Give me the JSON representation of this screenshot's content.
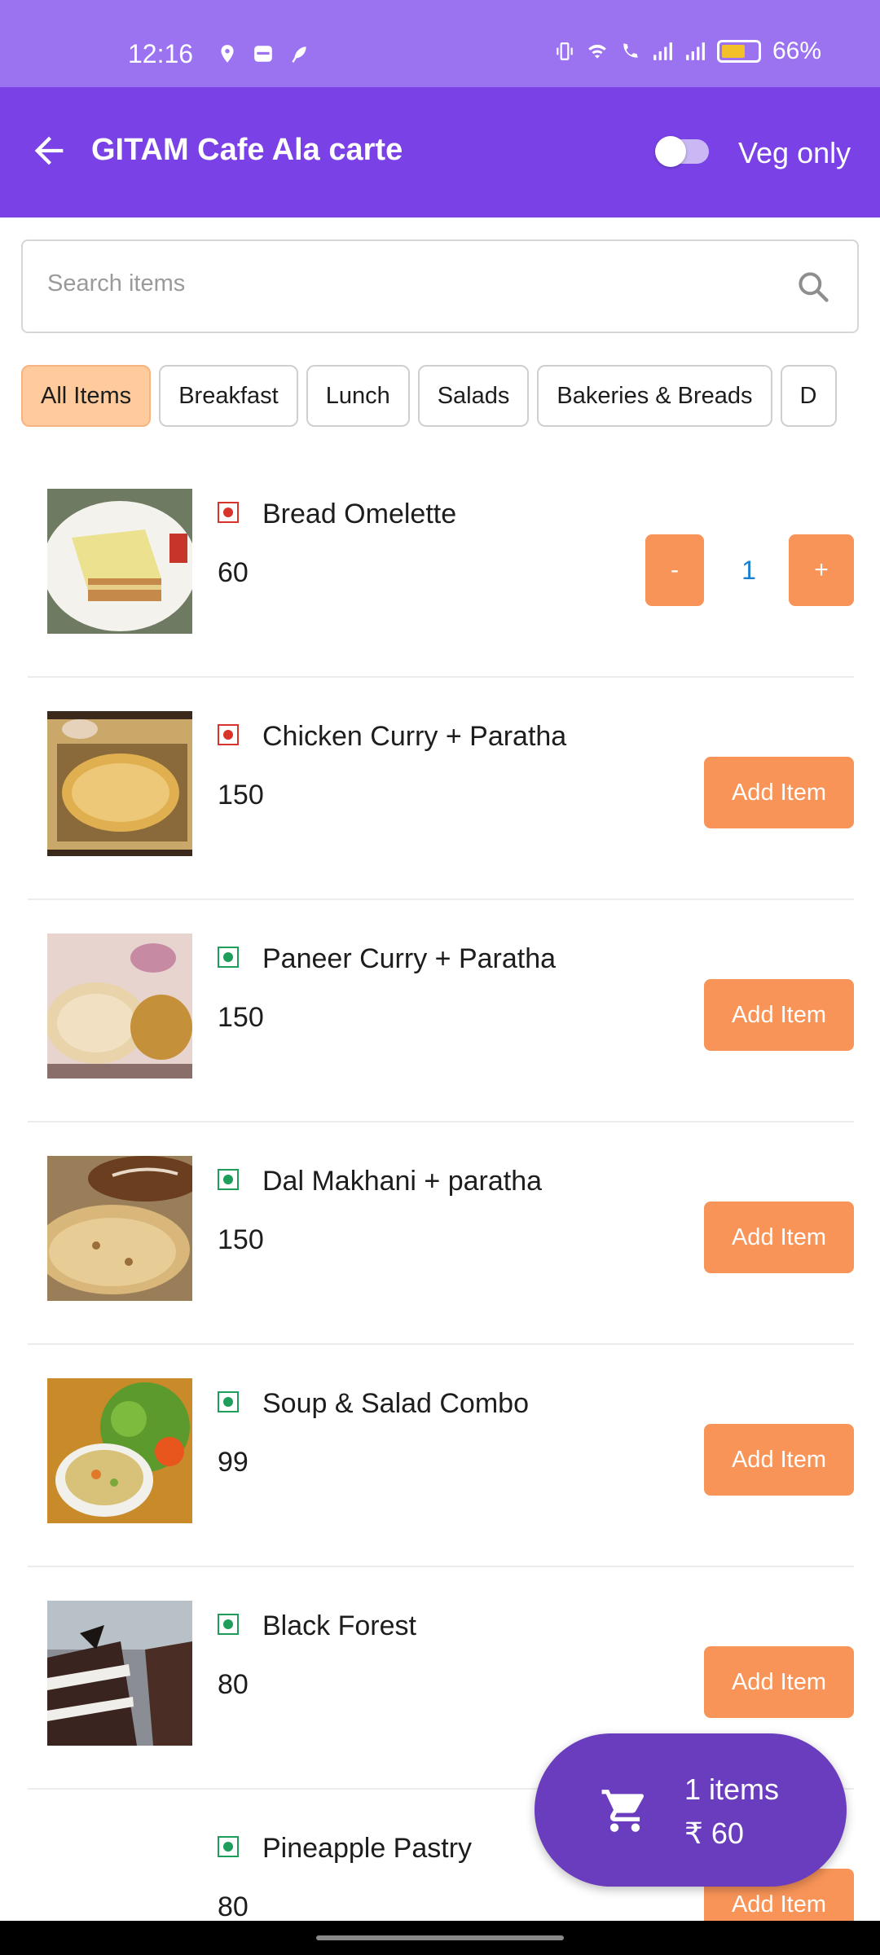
{
  "status": {
    "time": "12:16",
    "battery": "66%",
    "battery_level": 0.66
  },
  "appbar": {
    "title": "GITAM Cafe Ala carte",
    "veg_only_label": "Veg only",
    "veg_only_enabled": false
  },
  "search": {
    "placeholder": "Search items",
    "value": ""
  },
  "categories": {
    "items": [
      "All Items",
      "Breakfast",
      "Lunch",
      "Salads",
      "Bakeries & Breads",
      "D"
    ],
    "selected": "All Items"
  },
  "menu": {
    "add_label": "Add Item",
    "items": [
      {
        "name": "Bread Omelette",
        "price": "60",
        "type": "non-veg",
        "in_cart": true,
        "quantity": "1",
        "minus": "-",
        "plus": "+"
      },
      {
        "name": "Chicken Curry + Paratha",
        "price": "150",
        "type": "non-veg"
      },
      {
        "name": "Paneer Curry + Paratha",
        "price": "150",
        "type": "veg"
      },
      {
        "name": "Dal Makhani + paratha",
        "price": "150",
        "type": "veg"
      },
      {
        "name": "Soup & Salad Combo",
        "price": "99",
        "type": "veg"
      },
      {
        "name": "Black Forest",
        "price": "80",
        "type": "veg"
      },
      {
        "name": "Pineapple Pastry",
        "price": "80",
        "type": "veg"
      }
    ]
  },
  "cart": {
    "count_label": "1 items",
    "total_label": "₹ 60"
  },
  "colors": {
    "status_bar": "#9b72f0",
    "app_bar": "#7a42e6",
    "accent_orange": "#f89458",
    "chip_active": "#ffcb9d",
    "veg": "#1e9e5a",
    "non_veg": "#d9342b",
    "cart_fab": "#6a3dbf"
  }
}
